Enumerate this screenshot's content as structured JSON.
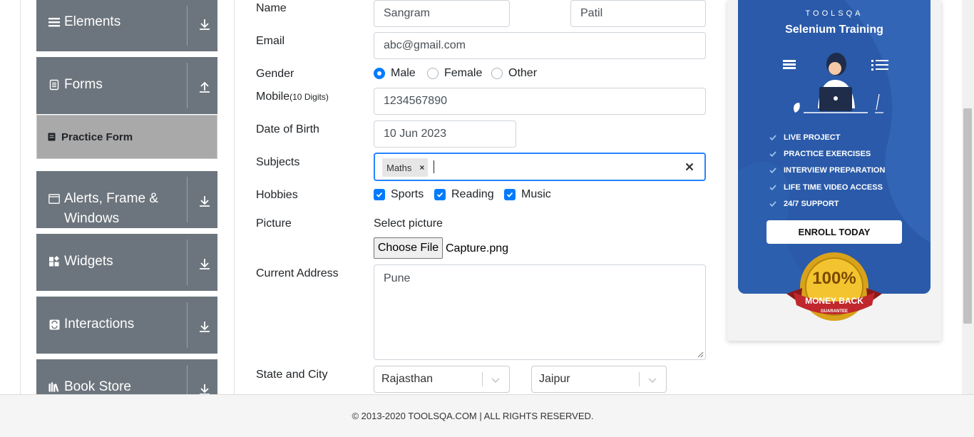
{
  "sidebar": {
    "groups": [
      {
        "label": "Elements",
        "icon": "hamburger-icon",
        "arrow": "download-arrow-icon"
      },
      {
        "label": "Forms",
        "icon": "document-icon",
        "arrow": "upload-arrow-icon"
      },
      {
        "label": "Alerts, Frame &",
        "label2": "Windows",
        "icon": "window-icon",
        "arrow": "download-arrow-icon"
      },
      {
        "label": "Widgets",
        "icon": "widgets-icon",
        "arrow": "download-arrow-icon"
      },
      {
        "label": "Interactions",
        "icon": "interactions-icon",
        "arrow": "download-arrow-icon"
      },
      {
        "label": "Book Store",
        "icon": "books-icon",
        "arrow": "download-arrow-icon"
      }
    ],
    "active_item": "Practice Form"
  },
  "form": {
    "name_label": "Name",
    "first_name": "Sangram",
    "last_name": "Patil",
    "email_label": "Email",
    "email": "abc@gmail.com",
    "gender_label": "Gender",
    "gender_options": [
      "Male",
      "Female",
      "Other"
    ],
    "gender_selected": "Male",
    "mobile_label": "Mobile",
    "mobile_hint": "(10 Digits)",
    "mobile": "1234567890",
    "dob_label": "Date of Birth",
    "dob": "10 Jun 2023",
    "subjects_label": "Subjects",
    "subjects": [
      "Maths"
    ],
    "chip_remove": "×",
    "hobbies_label": "Hobbies",
    "hobbies": [
      "Sports",
      "Reading",
      "Music"
    ],
    "picture_label": "Picture",
    "picture_prompt": "Select picture",
    "choose_file": "Choose File",
    "file_name": "Capture.png",
    "address_label": "Current Address",
    "address": "Pune",
    "state_city_label": "State and City",
    "state": "Rajasthan",
    "city": "Jaipur"
  },
  "ad": {
    "brand": "TOOLSQA",
    "title": "Selenium Training",
    "features": [
      "LIVE PROJECT",
      "PRACTICE EXERCISES",
      "INTERVIEW PREPARATION",
      "LIFE TIME VIDEO ACCESS",
      "24/7 SUPPORT"
    ],
    "cta": "ENROLL TODAY",
    "badge_percent": "100%",
    "badge_line": "MONEY BACK",
    "badge_small": "GUARANTEE"
  },
  "footer": {
    "text": "© 2013-2020 TOOLSQA.COM | ALL RIGHTS RESERVED."
  },
  "colors": {
    "sidebar_group": "#6c757d",
    "active_item": "#a9a9a9",
    "accent": "#007bff",
    "ad_blue": "#2a5aa9"
  }
}
